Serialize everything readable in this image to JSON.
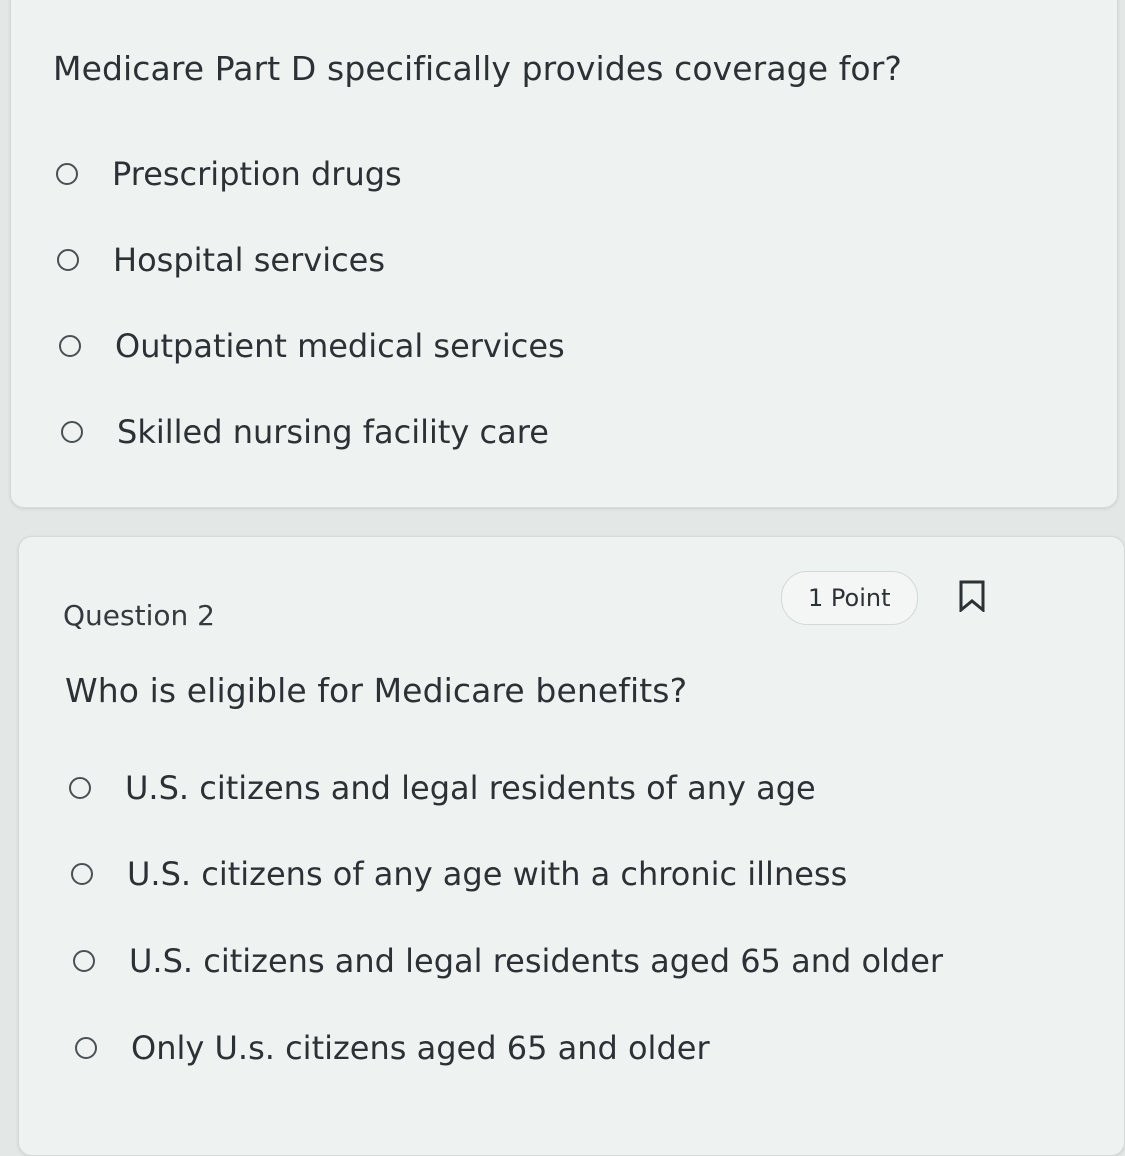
{
  "question1": {
    "text": "Medicare Part D specifically provides coverage for?",
    "options": [
      {
        "label": "Prescription drugs"
      },
      {
        "label": "Hospital services"
      },
      {
        "label": "Outpatient medical services"
      },
      {
        "label": "Skilled nursing facility care"
      }
    ]
  },
  "question2": {
    "number": "Question 2",
    "points": "1 Point",
    "text": "Who is eligible for Medicare benefits?",
    "options": [
      {
        "label": "U.S. citizens and legal residents of any age"
      },
      {
        "label": "U.S. citizens of any age with a chronic illness"
      },
      {
        "label": "U.S. citizens and legal residents aged 65 and older"
      },
      {
        "label": "Only U.s. citizens aged 65 and older"
      }
    ]
  },
  "icons": {
    "radio": "radio-circle-icon",
    "bookmark": "bookmark-icon"
  },
  "colors": {
    "background": "#e3e7e6",
    "card": "#eef2f1",
    "text": "#2b3134"
  }
}
